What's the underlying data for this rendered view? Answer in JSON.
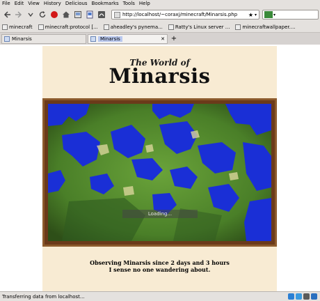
{
  "menubar": {
    "items": [
      "File",
      "Edit",
      "View",
      "History",
      "Delicious",
      "Bookmarks",
      "Tools",
      "Help"
    ]
  },
  "navbar": {
    "url": "http://localhost/~coraxj/minecraft/Minarsis.php",
    "buttons": [
      "back-icon",
      "forward-icon",
      "dropdown-icon",
      "reload-icon",
      "stop-icon",
      "home-icon",
      "tag-icon",
      "screenshot-icon",
      "sign-icon"
    ]
  },
  "bookmarks": [
    {
      "label": "minecraft",
      "icon": "folder-icon"
    },
    {
      "label": "minecraft:protocol [...",
      "icon": "page-icon"
    },
    {
      "label": "aheadley's pynema...",
      "icon": "github-icon"
    },
    {
      "label": "Ratty's Linux server ...",
      "icon": "page-icon"
    },
    {
      "label": "minecraftwallpaper....",
      "icon": "page-icon"
    }
  ],
  "tabs": [
    {
      "label": "Minarsis",
      "active": false
    },
    {
      "label": "Minarsis",
      "active": true
    }
  ],
  "page": {
    "title_small": "The World of",
    "title_big": "Minarsis",
    "loading": "Loading...",
    "status_line1": "Observing Minarsis since 2 days and 3 hours",
    "status_line2": "I sense no one wandering about."
  },
  "statusbar": {
    "text": "Transferring data from localhost..."
  },
  "colors": {
    "parchment": "#f8ebd3",
    "frame": "#6b3a1a",
    "water": "#1a2fd6",
    "grass": "#4f8f2a"
  }
}
